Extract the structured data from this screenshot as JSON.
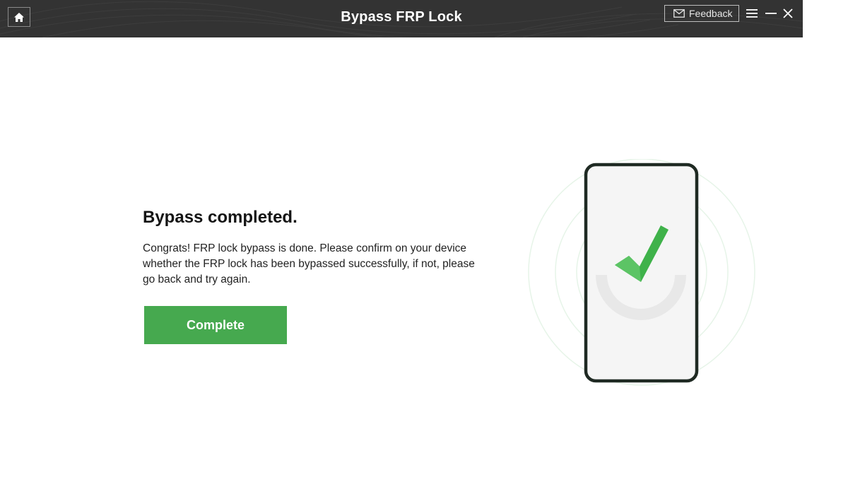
{
  "titlebar": {
    "title": "Bypass FRP Lock",
    "feedback_label": "Feedback",
    "background_color": "#333333",
    "icons": [
      "home-icon",
      "mail-icon",
      "menu-icon",
      "minimize-icon",
      "close-icon"
    ]
  },
  "main": {
    "heading": "Bypass completed.",
    "description": "Congrats! FRP lock bypass is done. Please confirm on your device whether the FRP lock has been bypassed successfully, if not, please go back and try again.",
    "complete_button": "Complete",
    "accent_color": "#46a94f"
  },
  "illustration": {
    "icon": "phone-check-icon"
  }
}
